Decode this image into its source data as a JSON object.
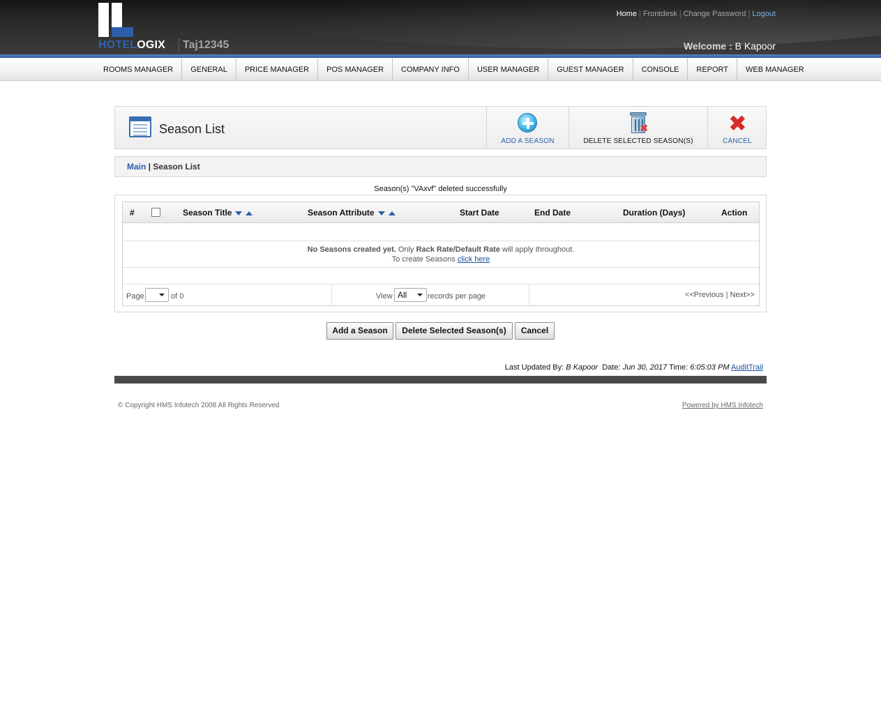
{
  "header": {
    "brand_part1": "HOTEL",
    "brand_part2": "OGIX",
    "hotel_code": "Taj12345",
    "links": {
      "home": "Home",
      "frontdesk": "Frontdesk",
      "change_password": "Change Password",
      "logout": "Logout",
      "separator": "|"
    },
    "welcome_label": "Welcome :",
    "welcome_user": "B Kapoor"
  },
  "menu": {
    "items": [
      "ROOMS MANAGER",
      "GENERAL",
      "PRICE MANAGER",
      "POS MANAGER",
      "COMPANY INFO",
      "USER MANAGER",
      "GUEST MANAGER",
      "CONSOLE",
      "REPORT",
      "WEB MANAGER"
    ]
  },
  "title_panel": {
    "title": "Season List",
    "add_label": "ADD A SEASON",
    "delete_label": "DELETE SELECTED SEASON(S)",
    "cancel_label": "CANCEL"
  },
  "breadcrumb": {
    "main": "Main",
    "separator": " | ",
    "current": "Season List"
  },
  "message": "Season(s) \"VAxvf\" deleted successfully",
  "table": {
    "columns": {
      "num": "#",
      "title": "Season Title",
      "attribute": "Season Attribute",
      "start": "Start Date",
      "end": "End Date",
      "duration": "Duration (Days)",
      "action": "Action"
    },
    "empty_bold1": "No Seasons created yet.",
    "empty_text1": " Only ",
    "empty_bold2": "Rack Rate/Default Rate",
    "empty_text2": " will apply throughout.",
    "create_text": "To create Seasons ",
    "create_link": "click here"
  },
  "pager": {
    "page_label": "Page",
    "page_value": "",
    "of_label": "of 0",
    "view_label": "View",
    "view_value": "All",
    "records_label": "records per page",
    "nav": "<<Previous | Next>>"
  },
  "buttons": {
    "add": "Add a Season",
    "delete": "Delete Selected Season(s)",
    "cancel": "Cancel"
  },
  "footer": {
    "last_updated_label": "Last Updated By: ",
    "last_updated_user": "B Kapoor",
    "date_label": "  Date: ",
    "date_value": "Jun 30, 2017",
    "time_label": " Time: ",
    "time_value": "6:05:03 PM",
    "audit_link": "AuditTrail",
    "copyright": "© Copyright HMS Infotech 2008 All Rights Reserved",
    "powered": "Powered by HMS Infotech"
  }
}
